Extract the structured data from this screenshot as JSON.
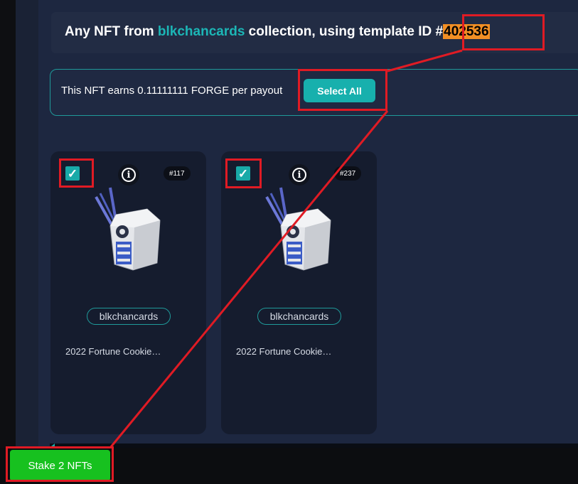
{
  "header": {
    "prefix": "Any NFT from ",
    "collection": "blkchancards",
    "middle": " collection, using template ID #",
    "template_id": "402536"
  },
  "earn": {
    "text": "This NFT earns 0.11111111 FORGE per payout",
    "select_all_label": "Select All"
  },
  "cards": [
    {
      "id_badge": "#117",
      "checked": true,
      "collection": "blkchancards",
      "title": "2022 Fortune Cookie…"
    },
    {
      "id_badge": "#237",
      "checked": true,
      "collection": "blkchancards",
      "title": "2022 Fortune Cookie…"
    }
  ],
  "stake_button_label": "Stake 2 NFTs",
  "icons": {
    "check": "checkbox-checked-icon",
    "info": "info-icon"
  },
  "colors": {
    "accent": "#17b0ad",
    "highlight": "#e01b24",
    "stake": "#17c11f",
    "template_id_bg": "#f28f24"
  }
}
